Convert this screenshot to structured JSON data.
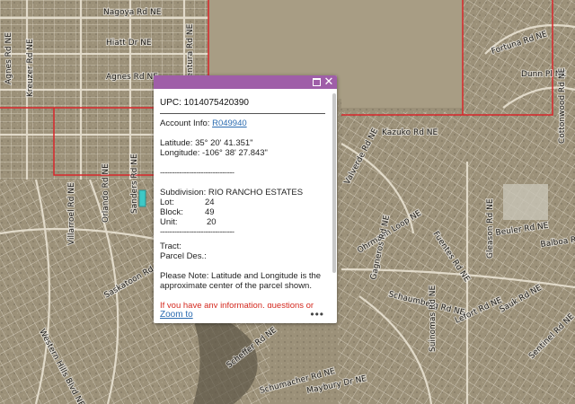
{
  "map": {
    "street_labels": [
      "Nagoya Rd NE",
      "Hiatt Dr NE",
      "Agnes Rd NE",
      "Agnes Rd NE",
      "Ventura Rd NE",
      "Kreuzer Rd NE",
      "Kazuko Rd NE",
      "Sanders Rd NE",
      "Orlando Rd NE",
      "Villarroel Rd NE",
      "Western Hills Blvd NE",
      "Saskatoon Rd NE",
      "Scheffer Rd NE",
      "Schumacher Rd NE",
      "Maybury Dr NE",
      "Fortuna Rd NE",
      "Dunn Pl NE",
      "Cottonwood Rd NE",
      "Valverde Rd NE",
      "Ohrmann Loop NE",
      "Gagneros Rd NE",
      "Fuentes Rd NE",
      "Schaumberg Rd NE",
      "Gleason Rd NE",
      "Beuler Rd NE",
      "Balboa Rd NE",
      "Suinomas Rd NE",
      "Lefort Rd NE",
      "Sauk Rd NE",
      "Sentinel Rd NE"
    ],
    "colors": {
      "terrain": "#9c9179",
      "parcel_lines": "#ece6d8",
      "boundary": "#d8262a",
      "selected_parcel": "#3ec9c6"
    }
  },
  "popup": {
    "title": "UPC: 1014075420390",
    "account_label": "Account Info:",
    "account_link": "R049940",
    "latitude": "Latitude: 35° 20' 41.351\"",
    "longitude": "Longitude: -106° 38' 27.843\"",
    "divider": "-------------------------------",
    "subdivision": "Subdivision: RIO RANCHO ESTATES",
    "lot_label": "Lot:",
    "lot_value": "24",
    "block_label": "Block:",
    "block_value": "49",
    "unit_label": "Unit:",
    "unit_value": "20",
    "tract": "Tract:",
    "parcel_des": "Parcel Des.:",
    "note": "Please Note: Latitude and Longitude is the approximate center of the parcel shown.",
    "info": "If you have any information, questions or",
    "zoom_label": "Zoom to",
    "more_label": "•••",
    "header_color": "#9f5ea8",
    "maximize_icon": "maximize-icon",
    "close_icon": "close-icon"
  }
}
